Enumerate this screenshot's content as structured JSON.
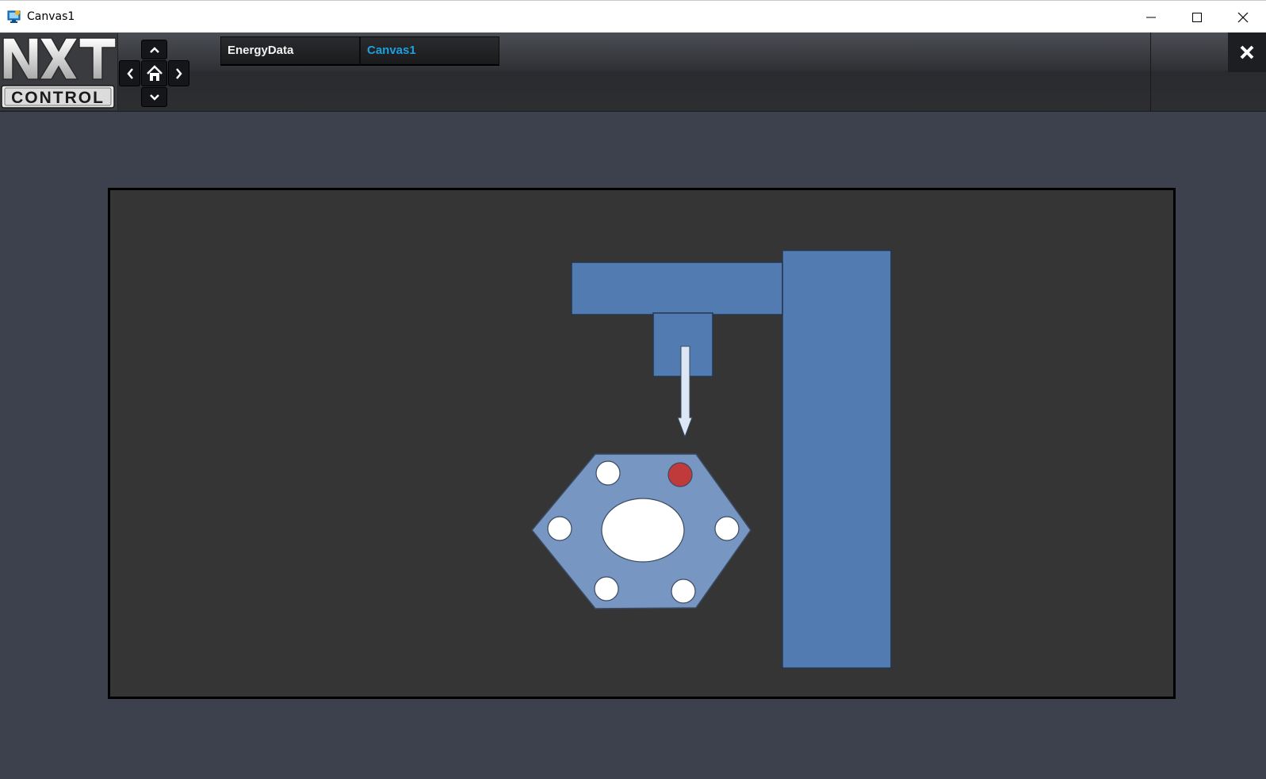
{
  "window": {
    "title": "Canvas1"
  },
  "header": {
    "logo_text": "NXT CONTROL",
    "tabs": [
      {
        "label": "EnergyData",
        "active": false
      },
      {
        "label": "Canvas1",
        "active": true
      }
    ]
  },
  "colors": {
    "page_background": "#3d414d",
    "canvas_background": "#353535",
    "machine_blue": "#527cb1",
    "part_blue": "#7896c2",
    "active_tab_text": "#1d9fe0",
    "marker_red": "#c0393b"
  },
  "icons": {
    "app": "canvas-app-icon",
    "minimize": "minimize-icon",
    "maximize": "maximize-icon",
    "close": "close-icon",
    "nav_up": "chevron-up-icon",
    "nav_down": "chevron-down-icon",
    "nav_left": "chevron-left-icon",
    "nav_right": "chevron-right-icon",
    "nav_home": "home-icon"
  },
  "scene": {
    "holes_total": 6,
    "holes_marked": 1
  }
}
